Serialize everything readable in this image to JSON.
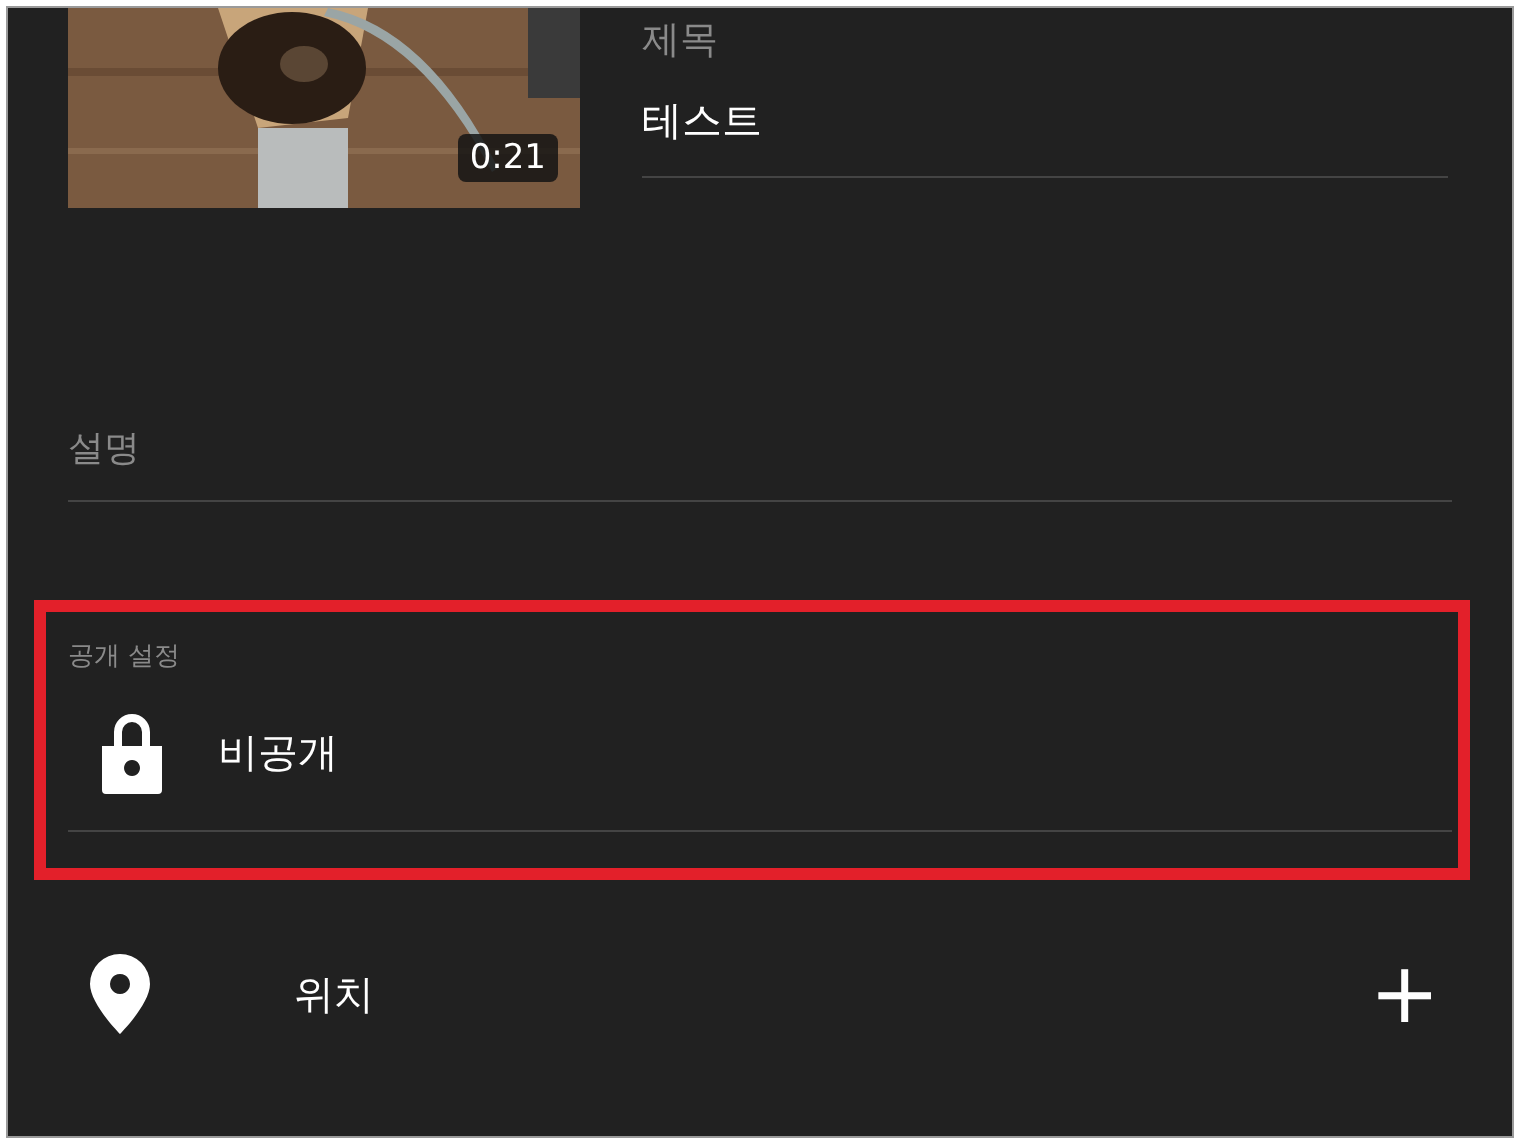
{
  "video": {
    "duration": "0:21"
  },
  "title_field": {
    "label": "제목",
    "value": "테스트"
  },
  "description_field": {
    "label": "설명"
  },
  "privacy": {
    "label": "공개 설정",
    "value": "비공개"
  },
  "location": {
    "label": "위치",
    "add": "+"
  }
}
